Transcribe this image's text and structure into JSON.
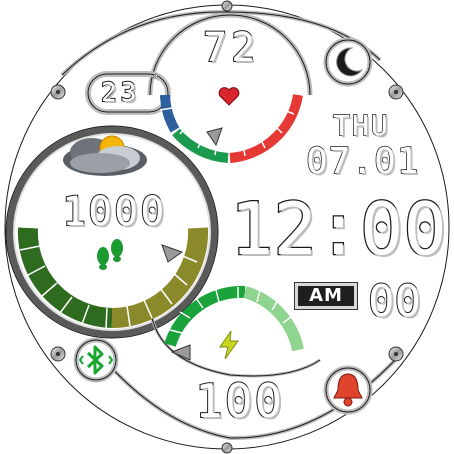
{
  "watch_face": {
    "heart_rate": {
      "value": "72",
      "icon": "heart-icon"
    },
    "weather": {
      "temperature": "23",
      "unit": "°",
      "icon": "partly-cloudy-icon"
    },
    "date": {
      "day": "THU",
      "date": "07.01"
    },
    "time": {
      "value": "12:00",
      "ampm": "AM",
      "seconds": "00"
    },
    "steps": {
      "value": "1000",
      "icon": "footsteps-icon"
    },
    "battery": {
      "value": "100",
      "icon": "lightning-bolt-icon"
    },
    "shortcuts": {
      "moon": "moon-icon",
      "alarm": "bell-icon",
      "bluetooth": "bluetooth-icon"
    }
  },
  "colors": {
    "heart": "#d9262c",
    "gauge_blue": "#2d5f9e",
    "gauge_green": "#1c9a4e",
    "gauge_red": "#e53935",
    "steps_dark": "#2e6b1f",
    "steps_olive": "#8a8a2a",
    "battery_green": "#1aa33a",
    "bolt": "#c8d820",
    "bell_red": "#e0442c",
    "bt_green": "#18a82e"
  }
}
